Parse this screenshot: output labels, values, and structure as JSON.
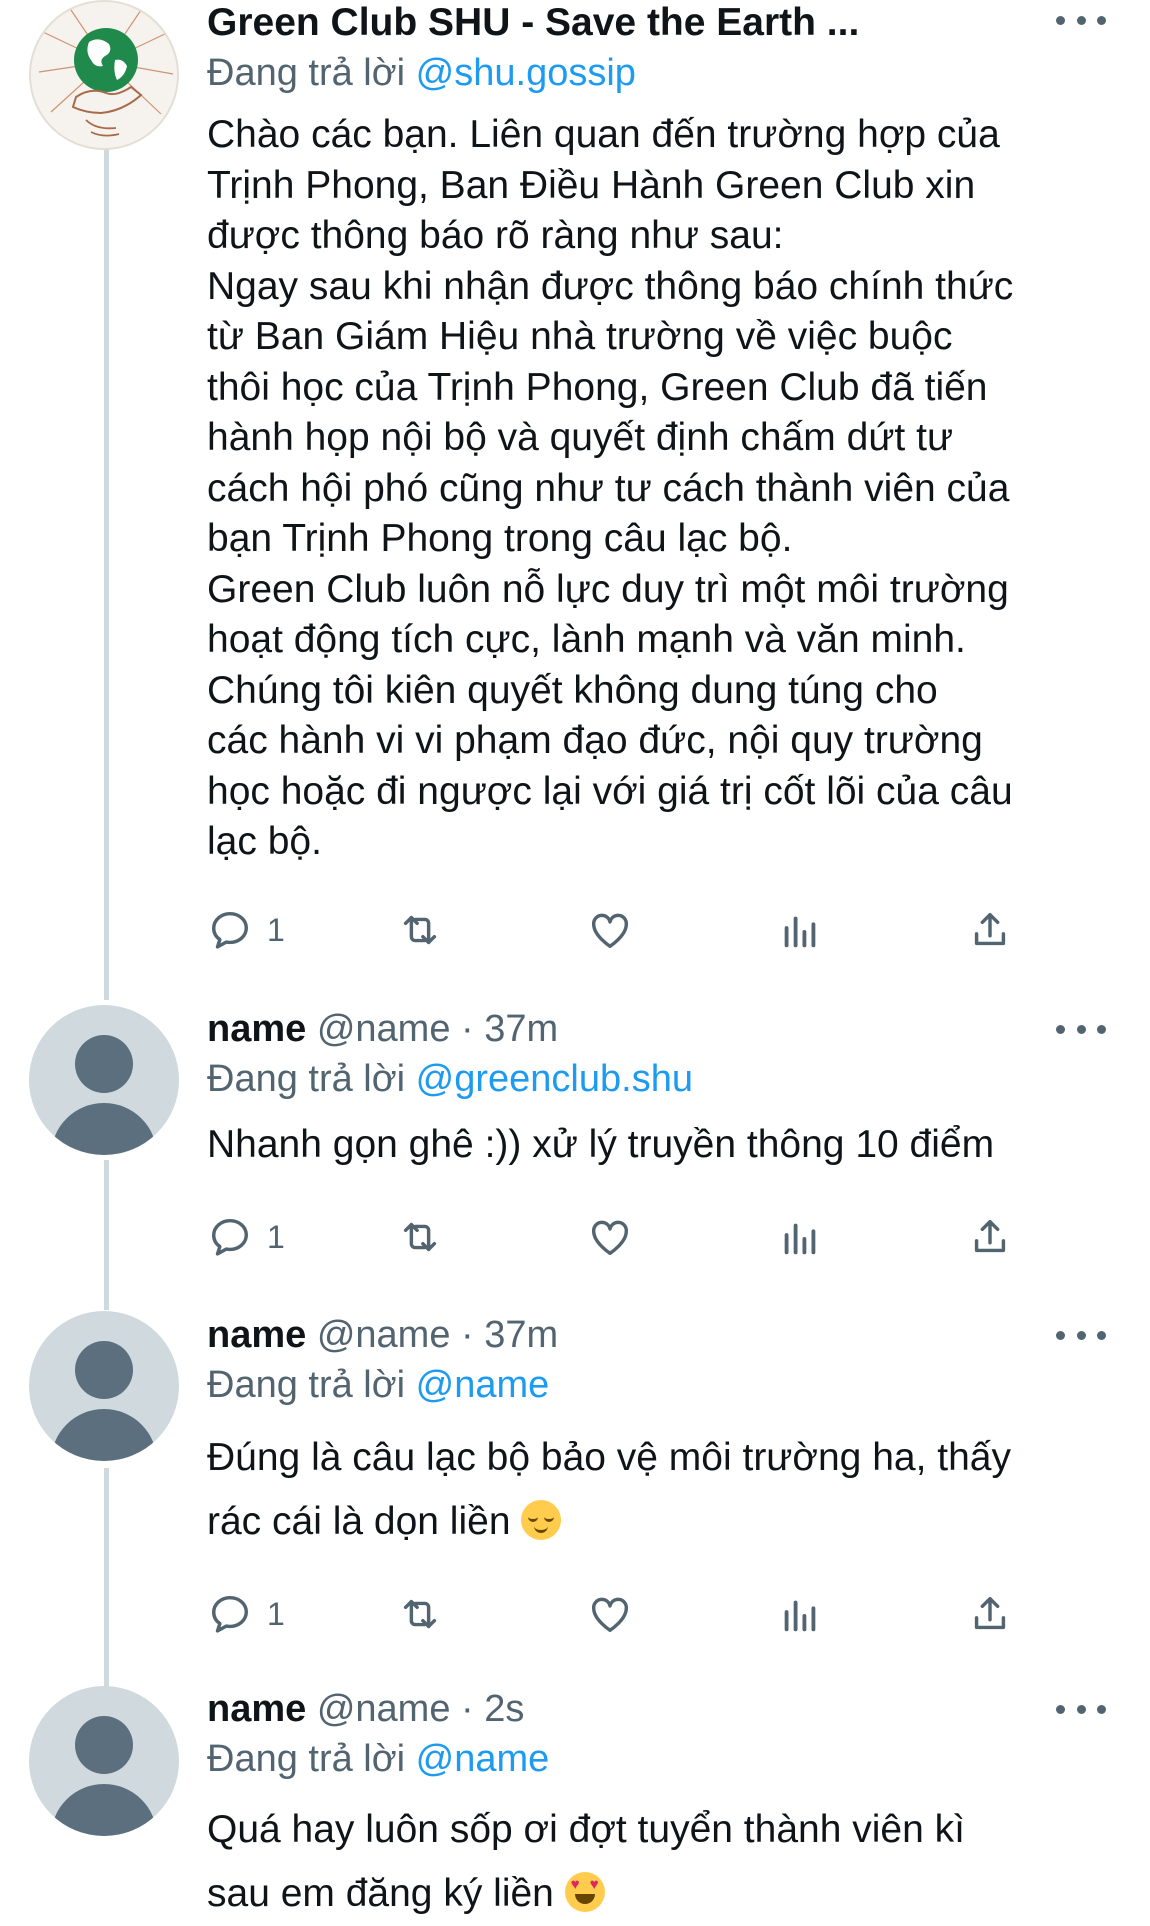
{
  "tweets": [
    {
      "display_name": "Green Club SHU - Save the Earth ...",
      "reply_prefix": "Đang trả lời ",
      "reply_to": "@shu.gossip",
      "text": "Chào các bạn. Liên quan đến trường hợp của\nTrịnh Phong, Ban Điều Hành Green Club xin\nđược thông báo rõ ràng như sau:\nNgay sau khi nhận được thông báo chính thức\ntừ Ban Giám Hiệu nhà trường về việc buộc\nthôi học của Trịnh Phong, Green Club đã tiến\nhành họp nội bộ và quyết định chấm dứt tư\ncách hội phó cũng như tư cách thành viên của\nbạn Trịnh Phong trong câu lạc bộ.\nGreen Club luôn nỗ lực duy trì một môi trường\nhoạt động tích cực, lành mạnh và văn minh.\nChúng tôi kiên quyết không dung túng cho\ncác hành vi vi phạm đạo đức, nội quy trường\nhọc hoặc đi ngược lại với giá trị cốt lõi của câu\nlạc bộ.",
      "reply_count": "1",
      "avatar_icon": "globe-in-hand-logo"
    },
    {
      "display_name": "name",
      "handle": "@name",
      "dot": "·",
      "time": "37m",
      "reply_prefix": "Đang trả lời ",
      "reply_to": "@greenclub.shu",
      "text": "Nhanh gọn ghê :)) xử lý truyền thông 10 điểm",
      "reply_count": "1",
      "avatar_icon": "default-avatar-icon"
    },
    {
      "display_name": "name",
      "handle": "@name",
      "dot": "·",
      "time": "37m",
      "reply_prefix": "Đang trả lời ",
      "reply_to": "@name",
      "text": "Đúng là câu lạc bộ bảo vệ môi trường ha, thấy\nrác cái là dọn liền ",
      "reply_count": "1",
      "emoji": "relieved-face",
      "avatar_icon": "default-avatar-icon"
    },
    {
      "display_name": "name",
      "handle": "@name",
      "dot": "·",
      "time": "2s",
      "reply_prefix": "Đang trả lời ",
      "reply_to": "@name",
      "text": "Quá hay luôn sốp ơi đợt tuyển thành viên kì\nsau em đăng ký liền ",
      "emoji": "heart-eyes-face",
      "avatar_icon": "default-avatar-icon"
    }
  ],
  "icons": {
    "reply": "reply-icon",
    "retweet": "retweet-icon",
    "like": "like-icon",
    "views": "views-icon",
    "share": "share-icon",
    "more": "more-icon"
  },
  "colors": {
    "link": "#1d9bf0",
    "secondary_text": "#536471",
    "thread_line": "#cfd9de",
    "logo_green": "#1f8a4c"
  }
}
